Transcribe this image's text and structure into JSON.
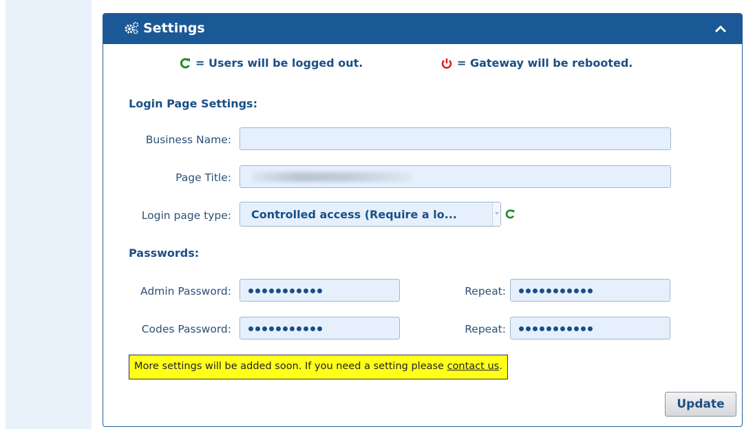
{
  "panel": {
    "title": "Settings",
    "icon": "gears-icon",
    "collapse_icon": "chevron-up-icon"
  },
  "legend": {
    "logout_text": "= Users will be logged out.",
    "logout_icon": "refresh-icon",
    "logout_color": "#1e8a2e",
    "reboot_text": "= Gateway will be rebooted.",
    "reboot_icon": "power-icon",
    "reboot_color": "#e0201b"
  },
  "login_section": {
    "title": "Login Page Settings:",
    "business_name_label": "Business Name:",
    "business_name_value": "",
    "page_title_label": "Page Title:",
    "login_type_label": "Login page type:",
    "login_type_value": "Controlled access (Require a lo..."
  },
  "passwords_section": {
    "title": "Passwords:",
    "admin_label": "Admin Password:",
    "admin_repeat_label": "Repeat:",
    "codes_label": "Codes Password:",
    "codes_repeat_label": "Repeat:",
    "masked_length": 11
  },
  "notice": {
    "text": "More settings will be added soon. If you need a setting please ",
    "link": "contact us",
    "suffix": ".",
    "background": "#ffff1a"
  },
  "actions": {
    "update_label": "Update"
  },
  "colors": {
    "header": "#1a5896",
    "label": "#2c4f77",
    "heading": "#1a4f86",
    "input_bg": "#e6f0fc"
  }
}
